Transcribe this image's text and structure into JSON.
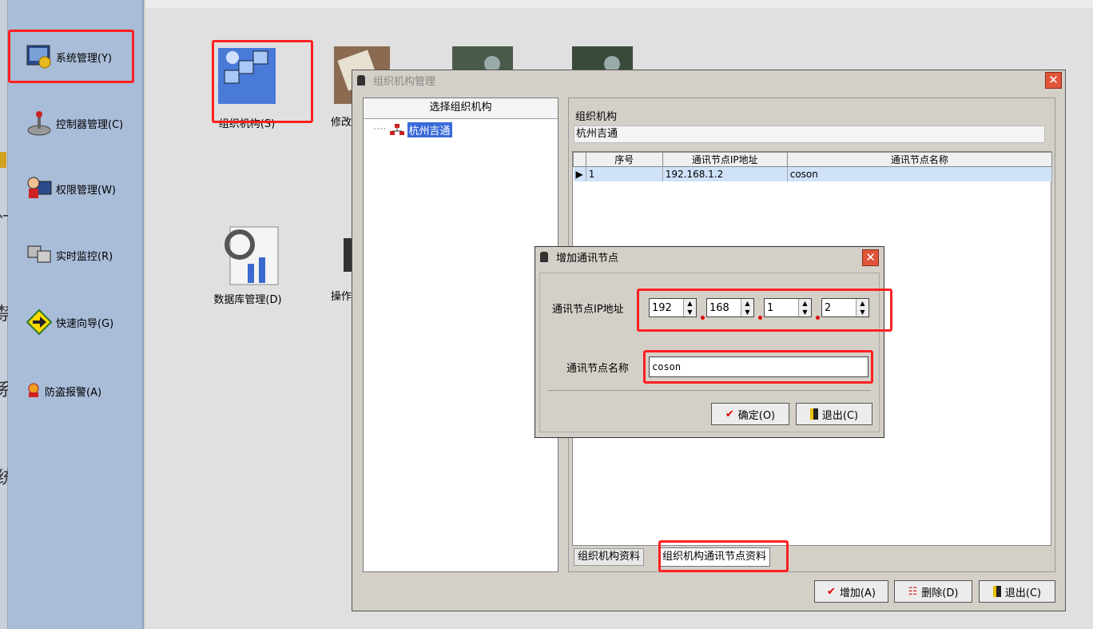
{
  "left_strip": {
    "chars": [
      "门",
      "禁",
      "系",
      "统"
    ]
  },
  "sidebar": {
    "items": [
      {
        "label": "系统管理(Y)",
        "icon": "monitor-gear-icon"
      },
      {
        "label": "控制器管理(C)",
        "icon": "joystick-icon"
      },
      {
        "label": "权限管理(W)",
        "icon": "user-computer-icon"
      },
      {
        "label": "实时监控(R)",
        "icon": "monitor-network-icon"
      },
      {
        "label": "快速向导(G)",
        "icon": "arrow-diamond-icon"
      },
      {
        "label": "防盗报警(A)",
        "icon": "alarm-user-icon"
      }
    ]
  },
  "main": {
    "icons": [
      {
        "label": "组织机构(S)",
        "icon": "org-network-icon"
      },
      {
        "label": "修改",
        "icon": "notebook-photo-icon"
      },
      {
        "label": "",
        "icon": "camera-photo-icon"
      },
      {
        "label": "",
        "icon": "camera-photo-icon"
      },
      {
        "label": "数据库管理(D)",
        "icon": "database-refresh-icon"
      },
      {
        "label": "操作",
        "icon": "device-icon"
      }
    ]
  },
  "org_window": {
    "title": "组织机构管理",
    "tree_header": "选择组织机构",
    "tree_root": "杭州吉通",
    "org_label": "组织机构",
    "org_value": "杭州吉通",
    "table": {
      "headers": [
        "",
        "序号",
        "通讯节点IP地址",
        "通讯节点名称"
      ],
      "rows": [
        {
          "marker": "▶",
          "index": "1",
          "ip": "192.168.1.2",
          "name": "coson"
        }
      ]
    },
    "tabs": [
      "组织机构资料",
      "组织机构通讯节点资料"
    ],
    "buttons": {
      "add": "增加(A)",
      "delete": "删除(D)",
      "exit": "退出(C)"
    }
  },
  "node_dialog": {
    "title": "增加通讯节点",
    "ip_label": "通讯节点IP地址",
    "ip_parts": [
      "192",
      "168",
      "1",
      "2"
    ],
    "name_label": "通讯节点名称",
    "name_value": "coson",
    "ok": "确定(O)",
    "exit": "退出(C)"
  },
  "colors": {
    "highlight": "#ff2020",
    "sidebar": "#a9bcd8",
    "title_active": "#d4d0c8"
  }
}
